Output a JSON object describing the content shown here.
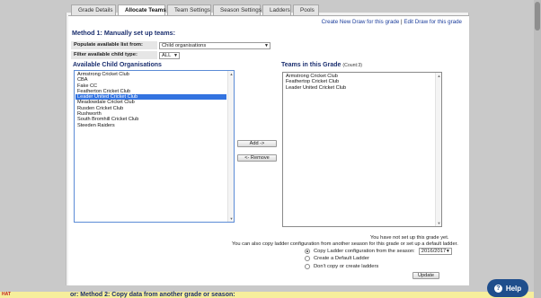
{
  "tabs": [
    {
      "label": "Grade Details",
      "active": false
    },
    {
      "label": "Allocate Teams",
      "active": true
    },
    {
      "label": "Team Settings",
      "active": false
    },
    {
      "label": "Season Settings",
      "active": false
    },
    {
      "label": "Ladders",
      "active": false
    },
    {
      "label": "Pools",
      "active": false
    }
  ],
  "links": {
    "create_draw": "Create New Draw for this grade",
    "separator": " | ",
    "edit_draw": "Edit Draw for this grade"
  },
  "method1": {
    "title": "Method 1: Manually set up teams:",
    "populate_label": "Populate available list from:",
    "populate_value": "Child organisations",
    "filter_label": "Filter available child type:",
    "filter_value": "ALL"
  },
  "available": {
    "title": "Available Child Organisations",
    "items": [
      "Armstrong Cricket Club",
      "CBA",
      "Fake CC",
      "Featherton Cricket Club",
      "Leader United Cricket Club",
      "Meadowdale Cricket Club",
      "Rusden Cricket Club",
      "Rushworth",
      "South Bromhill Cricket Club",
      "Steeden Raiders"
    ],
    "selected_index": 4
  },
  "teams": {
    "title": "Teams in this Grade",
    "count": "(Count:3)",
    "items": [
      "Armstrong Cricket Club",
      "Feathertop Cricket Club",
      "Leader United Cricket Club"
    ]
  },
  "buttons": {
    "add": "Add ->",
    "remove": "<- Remove",
    "update": "Update"
  },
  "ladder": {
    "note1": "You have not set up this grade yet.",
    "note2": "You can also copy ladder configuration from another season for this grade or set up a default ladder.",
    "option_copy": "Copy Ladder configuration from the season:",
    "season_value": "2016/2017",
    "option_default": "Create a Default Ladder",
    "option_none": "Don't copy or create ladders"
  },
  "method2": {
    "title": "or: Method 2: Copy data from another grade or season:"
  },
  "warning_tab": "HAT",
  "help": {
    "label": "Help",
    "icon": "?"
  },
  "icons": {
    "dropdown": "chevron-down-icon",
    "help": "question-icon"
  }
}
